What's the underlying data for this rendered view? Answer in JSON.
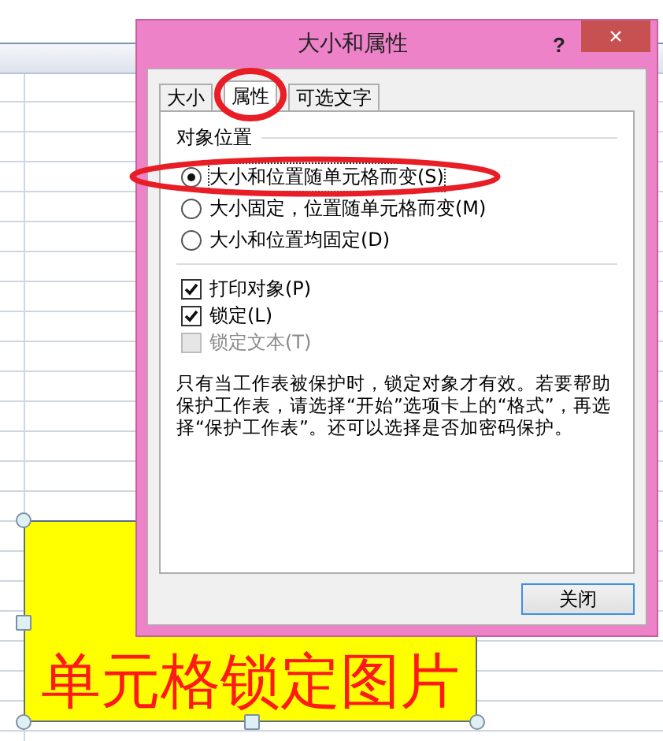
{
  "sheet": {
    "shape_text": "单元格锁定图片"
  },
  "dialog": {
    "title": "大小和属性",
    "help": "?",
    "close": "×",
    "tabs": [
      {
        "label": "大小",
        "selected": false
      },
      {
        "label": "属性",
        "selected": true,
        "circled": true
      },
      {
        "label": "可选文字",
        "selected": false
      }
    ],
    "section": "对象位置",
    "radios": [
      {
        "label": "大小和位置随单元格而变(S)",
        "selected": true,
        "circled": true
      },
      {
        "label": "大小固定，位置随单元格而变(M)",
        "selected": false
      },
      {
        "label": "大小和位置均固定(D)",
        "selected": false
      }
    ],
    "checkboxes": [
      {
        "label": "打印对象(P)",
        "checked": true,
        "disabled": false
      },
      {
        "label": "锁定(L)",
        "checked": true,
        "disabled": false
      },
      {
        "label": "锁定文本(T)",
        "checked": false,
        "disabled": true
      }
    ],
    "note": "只有当工作表被保护时，锁定对象才有效。若要帮助保护工作表，请选择“开始”选项卡上的“格式”，再选择“保护工作表”。还可以选择是否加密码保护。",
    "buttons": [
      "关闭"
    ]
  }
}
